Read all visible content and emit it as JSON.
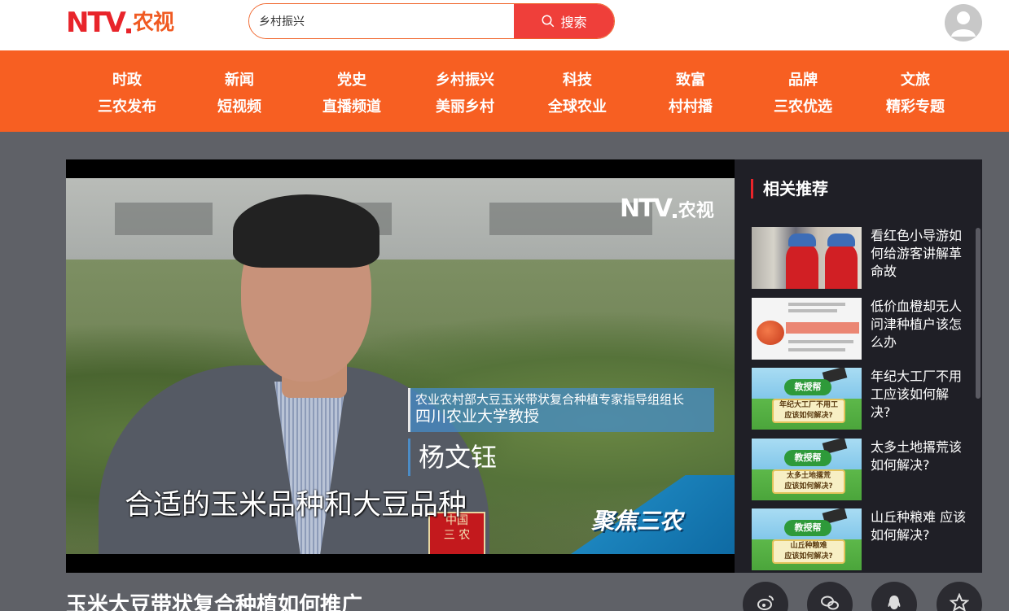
{
  "header": {
    "logo_ntv": "NTV",
    "logo_cn": "农视",
    "search_value": "乡村振兴",
    "search_button": "搜索"
  },
  "nav": [
    {
      "top": "时政",
      "bottom": "三农发布"
    },
    {
      "top": "新闻",
      "bottom": "短视频"
    },
    {
      "top": "党史",
      "bottom": "直播频道"
    },
    {
      "top": "乡村振兴",
      "bottom": "美丽乡村"
    },
    {
      "top": "科技",
      "bottom": "全球农业"
    },
    {
      "top": "致富",
      "bottom": "村村播"
    },
    {
      "top": "品牌",
      "bottom": "三农优选"
    },
    {
      "top": "文旅",
      "bottom": "精彩专题"
    }
  ],
  "video": {
    "watermark_ntv": "NTV",
    "watermark_cn": "农视",
    "caption_title_1": "农业农村部大豆玉米带状复合种植专家指导组组长",
    "caption_title_2": "四川农业大学教授",
    "caption_name": "杨文钰",
    "subtitle": "合适的玉米品种和大豆品种",
    "program_logo": "聚焦三农",
    "book_text_1": "中国",
    "book_text_2": "三 农"
  },
  "sidebar": {
    "title": "相关推荐",
    "items": [
      {
        "title": "看红色小导游如何给游客讲解革命故"
      },
      {
        "title": "低价血橙却无人问津种植户该怎么办"
      },
      {
        "title": "年纪大工厂不用工应该如何解决?",
        "thumb_tag": "教授帮",
        "thumb_text_1": "年纪大工厂不用工",
        "thumb_text_2": "应该如何解决?"
      },
      {
        "title": "太多土地撂荒该如何解决?",
        "thumb_tag": "教授帮",
        "thumb_text_1": "太多土地撂荒",
        "thumb_text_2": "应该如何解决?"
      },
      {
        "title": "山丘种粮难 应该如何解决?",
        "thumb_tag": "教授帮",
        "thumb_text_1": "山丘种粮难",
        "thumb_text_2": "应该如何解决?"
      }
    ]
  },
  "page": {
    "title": "玉米大豆带状复合种植如何推广"
  },
  "colors": {
    "brand_red": "#e8242a",
    "nav_orange": "#f75f22",
    "search_button": "#ef3f3a",
    "page_background": "#5f6167",
    "sidebar_background": "#1f1f26"
  }
}
